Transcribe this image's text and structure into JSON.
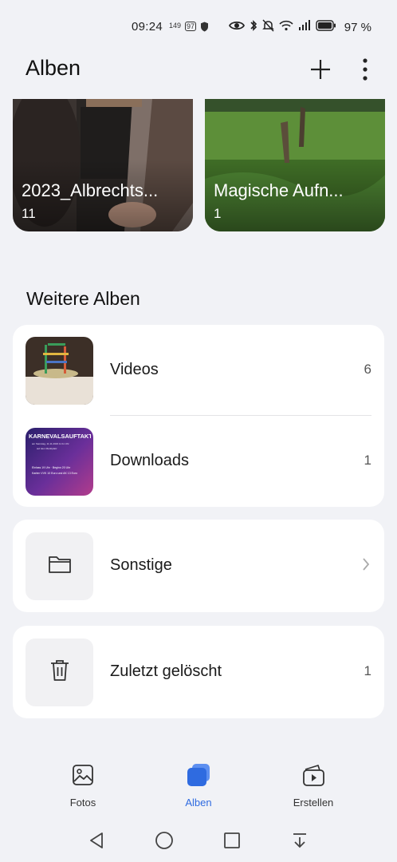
{
  "status_bar": {
    "time": "09:24",
    "mini_1": "149",
    "mini_2": "97",
    "battery": "97 %"
  },
  "header": {
    "title": "Alben",
    "add_icon": "plus-icon",
    "more_icon": "more-vertical-icon"
  },
  "albums": [
    {
      "name": "2023_Albrechts...",
      "count": "11"
    },
    {
      "name": "Magische Aufn...",
      "count": "1"
    }
  ],
  "more_albums": {
    "title": "Weitere Alben",
    "items": [
      {
        "label": "Videos",
        "count": "6"
      },
      {
        "label": "Downloads",
        "count": "1"
      }
    ]
  },
  "other": {
    "label": "Sonstige",
    "icon": "folder-icon"
  },
  "trash": {
    "label": "Zuletzt gelöscht",
    "count": "1",
    "icon": "trash-icon"
  },
  "downloads_thumb_text": {
    "headline": "KARNEVALSAUFTAKT",
    "line1": "am Samstag, 11.11.2023 11:11 Uhr",
    "line2": "auf dem Marktplatz",
    "line3": "Einlass 19 Uhr · Beginn 20 Uhr",
    "line4": "Karten VVK 10 Euro und AK 13 Euro"
  },
  "tabs": [
    {
      "label": "Fotos",
      "icon": "image-icon",
      "active": false
    },
    {
      "label": "Alben",
      "icon": "albums-icon",
      "active": true
    },
    {
      "label": "Erstellen",
      "icon": "create-icon",
      "active": false
    }
  ],
  "colors": {
    "accent": "#2f6be0",
    "background": "#f1f2f6",
    "card": "#ffffff"
  }
}
